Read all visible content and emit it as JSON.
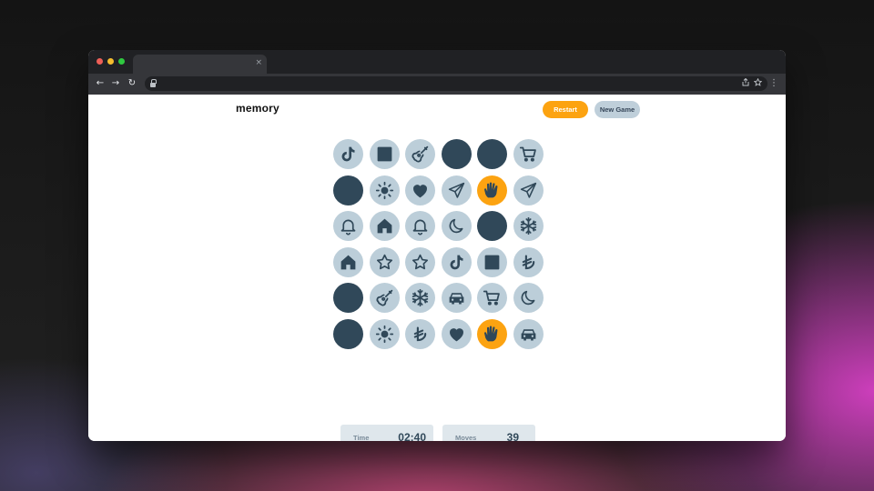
{
  "browser": {
    "tab_close": "×",
    "nav": {
      "back": "←",
      "forward": "→",
      "reload": "↻"
    },
    "omnibox_icons": [
      "share-icon",
      "star-icon"
    ],
    "menu": "⋮"
  },
  "app": {
    "brand": "memory",
    "restart_label": "Restart",
    "new_game_label": "New Game"
  },
  "board": {
    "rows": [
      [
        {
          "state": "revealed",
          "icon": "tiktok"
        },
        {
          "state": "revealed",
          "icon": "square"
        },
        {
          "state": "revealed",
          "icon": "guitar"
        },
        {
          "state": "hidden"
        },
        {
          "state": "hidden"
        },
        {
          "state": "revealed",
          "icon": "cart"
        }
      ],
      [
        {
          "state": "hidden"
        },
        {
          "state": "revealed",
          "icon": "sun"
        },
        {
          "state": "revealed",
          "icon": "heart"
        },
        {
          "state": "revealed",
          "icon": "paper-plane"
        },
        {
          "state": "active",
          "icon": "vulcan-hand"
        },
        {
          "state": "revealed",
          "icon": "paper-plane"
        }
      ],
      [
        {
          "state": "revealed",
          "icon": "bell"
        },
        {
          "state": "revealed",
          "icon": "house"
        },
        {
          "state": "revealed",
          "icon": "bell"
        },
        {
          "state": "revealed",
          "icon": "moon"
        },
        {
          "state": "hidden"
        },
        {
          "state": "revealed",
          "icon": "snowflake"
        }
      ],
      [
        {
          "state": "revealed",
          "icon": "house"
        },
        {
          "state": "revealed",
          "icon": "star"
        },
        {
          "state": "revealed",
          "icon": "star"
        },
        {
          "state": "revealed",
          "icon": "tiktok"
        },
        {
          "state": "revealed",
          "icon": "square"
        },
        {
          "state": "revealed",
          "icon": "lira"
        }
      ],
      [
        {
          "state": "hidden"
        },
        {
          "state": "revealed",
          "icon": "guitar"
        },
        {
          "state": "revealed",
          "icon": "snowflake"
        },
        {
          "state": "revealed",
          "icon": "car"
        },
        {
          "state": "revealed",
          "icon": "cart"
        },
        {
          "state": "revealed",
          "icon": "moon"
        }
      ],
      [
        {
          "state": "hidden"
        },
        {
          "state": "revealed",
          "icon": "sun"
        },
        {
          "state": "revealed",
          "icon": "lira"
        },
        {
          "state": "revealed",
          "icon": "heart"
        },
        {
          "state": "active",
          "icon": "vulcan-hand"
        },
        {
          "state": "revealed",
          "icon": "car"
        }
      ]
    ]
  },
  "stats": {
    "time_label": "Time",
    "time_value": "02:40",
    "moves_label": "Moves",
    "moves_value": "39"
  },
  "colors": {
    "accent": "#fca311",
    "tile_revealed": "#bcced9",
    "tile_hidden": "#304859",
    "icon": "#304859",
    "stat_bg": "#dfe7ec"
  }
}
